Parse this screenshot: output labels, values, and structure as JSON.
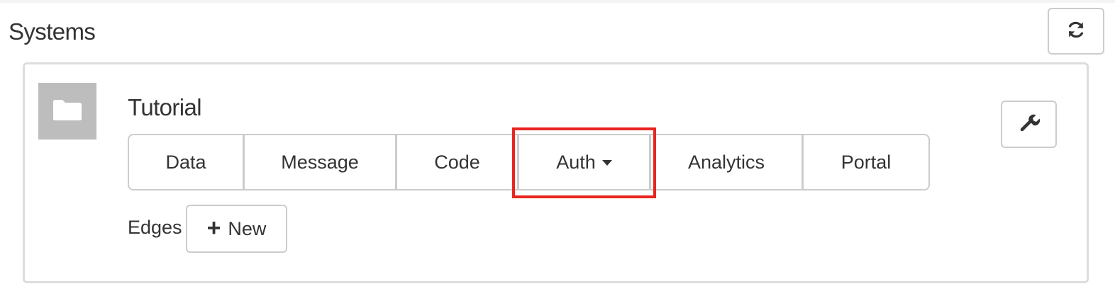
{
  "header": {
    "title": "Systems",
    "refresh_icon": "refresh-icon"
  },
  "system": {
    "name": "Tutorial",
    "thumbnail_icon": "folder-icon",
    "settings_icon": "wrench-icon",
    "tabs": [
      {
        "label": "Data"
      },
      {
        "label": "Message"
      },
      {
        "label": "Code"
      },
      {
        "label": "Auth",
        "has_dropdown": true,
        "highlighted": true
      },
      {
        "label": "Analytics"
      },
      {
        "label": "Portal"
      }
    ],
    "edges": {
      "label": "Edges",
      "new_button_label": "New",
      "new_button_icon": "plus-icon"
    }
  },
  "colors": {
    "highlight": "#e8251f",
    "border": "#cccccc",
    "thumbnail_bg": "#bdbdbd"
  }
}
